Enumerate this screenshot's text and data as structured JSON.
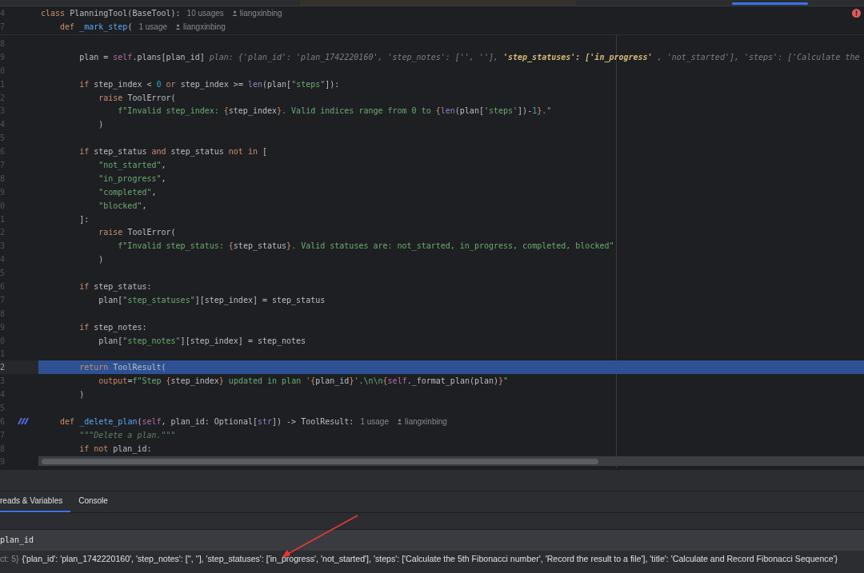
{
  "editor": {
    "problems": {
      "kind": "error"
    },
    "sticky_lines": [
      {
        "number": "4",
        "segments": [
          {
            "kind": "kw",
            "t": "class "
          },
          {
            "kind": "plain",
            "t": "PlanningTool(BaseTool):"
          },
          {
            "kind": "usages",
            "t": "10 usages"
          },
          {
            "kind": "author",
            "t": "liangxinbing"
          }
        ]
      },
      {
        "number": "7",
        "segments": [
          {
            "kind": "kw",
            "t": "    def "
          },
          {
            "kind": "fn",
            "t": "_mark_step"
          },
          {
            "kind": "plain",
            "t": "("
          },
          {
            "kind": "usages",
            "t": "1 usage"
          },
          {
            "kind": "author",
            "t": "liangxinbing"
          }
        ]
      }
    ],
    "lines": [
      {
        "number": "8",
        "current": false,
        "gutter_mark": false
      },
      {
        "number": "9",
        "current": false,
        "gutter_mark": false,
        "segments": [
          {
            "kind": "plain",
            "t": "        plan = "
          },
          {
            "kind": "self",
            "t": "self"
          },
          {
            "kind": "plain",
            "t": ".plans[plan_id]"
          },
          {
            "kind": "hint",
            "t": "plan: {'plan_id': 'plan_1742220160', 'step_notes': ['', ''], "
          },
          {
            "kind": "hint_hl",
            "t": "'step_statuses': ['in_progress'"
          },
          {
            "kind": "hint",
            "t": ", 'not_started'], 'steps': ['Calculate the"
          }
        ]
      },
      {
        "number": "0",
        "current": false,
        "gutter_mark": false
      },
      {
        "number": "1",
        "current": false,
        "gutter_mark": false,
        "segments": [
          {
            "kind": "kw",
            "t": "        if "
          },
          {
            "kind": "plain",
            "t": "step_index < "
          },
          {
            "kind": "num",
            "t": "0"
          },
          {
            "kind": "kw",
            "t": " or "
          },
          {
            "kind": "plain",
            "t": "step_index >= "
          },
          {
            "kind": "builtin",
            "t": "len"
          },
          {
            "kind": "plain",
            "t": "(plan["
          },
          {
            "kind": "str",
            "t": "\"steps\""
          },
          {
            "kind": "plain",
            "t": "]):"
          }
        ]
      },
      {
        "number": "2",
        "current": false,
        "gutter_mark": false,
        "segments": [
          {
            "kind": "kw",
            "t": "            raise "
          },
          {
            "kind": "plain",
            "t": "ToolError("
          }
        ]
      },
      {
        "number": "3",
        "current": false,
        "gutter_mark": false,
        "segments": [
          {
            "kind": "str",
            "t": "                f\"Invalid step_index: "
          },
          {
            "kind": "brace",
            "t": "{"
          },
          {
            "kind": "plain",
            "t": "step_index"
          },
          {
            "kind": "brace",
            "t": "}"
          },
          {
            "kind": "str",
            "t": ". Valid indices range from 0 to "
          },
          {
            "kind": "brace",
            "t": "{"
          },
          {
            "kind": "builtin",
            "t": "len"
          },
          {
            "kind": "plain",
            "t": "(plan["
          },
          {
            "kind": "str",
            "t": "'steps'"
          },
          {
            "kind": "plain",
            "t": "])-"
          },
          {
            "kind": "num",
            "t": "1"
          },
          {
            "kind": "brace",
            "t": "}"
          },
          {
            "kind": "str",
            "t": ".\""
          }
        ]
      },
      {
        "number": "4",
        "current": false,
        "gutter_mark": false,
        "segments": [
          {
            "kind": "plain",
            "t": "            )"
          }
        ]
      },
      {
        "number": "5",
        "current": false,
        "gutter_mark": false
      },
      {
        "number": "6",
        "current": false,
        "gutter_mark": false,
        "segments": [
          {
            "kind": "kw",
            "t": "        if "
          },
          {
            "kind": "plain",
            "t": "step_status "
          },
          {
            "kind": "kw",
            "t": "and "
          },
          {
            "kind": "plain",
            "t": "step_status "
          },
          {
            "kind": "kw",
            "t": "not in "
          },
          {
            "kind": "plain",
            "t": "["
          }
        ]
      },
      {
        "number": "7",
        "current": false,
        "gutter_mark": false,
        "segments": [
          {
            "kind": "str",
            "t": "            \"not_started\""
          },
          {
            "kind": "plain",
            "t": ","
          }
        ]
      },
      {
        "number": "8",
        "current": false,
        "gutter_mark": false,
        "segments": [
          {
            "kind": "str",
            "t": "            \"in_progress\""
          },
          {
            "kind": "plain",
            "t": ","
          }
        ]
      },
      {
        "number": "9",
        "current": false,
        "gutter_mark": false,
        "segments": [
          {
            "kind": "str",
            "t": "            \"completed\""
          },
          {
            "kind": "plain",
            "t": ","
          }
        ]
      },
      {
        "number": "0",
        "current": false,
        "gutter_mark": false,
        "segments": [
          {
            "kind": "str",
            "t": "            \"blocked\""
          },
          {
            "kind": "plain",
            "t": ","
          }
        ]
      },
      {
        "number": "1",
        "current": false,
        "gutter_mark": false,
        "segments": [
          {
            "kind": "plain",
            "t": "        ]:"
          }
        ]
      },
      {
        "number": "2",
        "current": false,
        "gutter_mark": false,
        "segments": [
          {
            "kind": "kw",
            "t": "            raise "
          },
          {
            "kind": "plain",
            "t": "ToolError("
          }
        ]
      },
      {
        "number": "3",
        "current": false,
        "gutter_mark": false,
        "segments": [
          {
            "kind": "str",
            "t": "                f\"Invalid step_status: "
          },
          {
            "kind": "brace",
            "t": "{"
          },
          {
            "kind": "plain",
            "t": "step_status"
          },
          {
            "kind": "brace",
            "t": "}"
          },
          {
            "kind": "str",
            "t": ". Valid statuses are: not_started, in_progress, completed, blocked\""
          }
        ]
      },
      {
        "number": "4",
        "current": false,
        "gutter_mark": false,
        "segments": [
          {
            "kind": "plain",
            "t": "            )"
          }
        ]
      },
      {
        "number": "5",
        "current": false,
        "gutter_mark": false
      },
      {
        "number": "6",
        "current": false,
        "gutter_mark": false,
        "segments": [
          {
            "kind": "kw",
            "t": "        if "
          },
          {
            "kind": "plain",
            "t": "step_status:"
          }
        ]
      },
      {
        "number": "7",
        "current": false,
        "gutter_mark": false,
        "segments": [
          {
            "kind": "plain",
            "t": "            plan["
          },
          {
            "kind": "str",
            "t": "\"step_statuses\""
          },
          {
            "kind": "plain",
            "t": "][step_index] = step_status"
          }
        ]
      },
      {
        "number": "8",
        "current": false,
        "gutter_mark": false
      },
      {
        "number": "9",
        "current": false,
        "gutter_mark": false,
        "segments": [
          {
            "kind": "kw",
            "t": "        if "
          },
          {
            "kind": "plain",
            "t": "step_notes:"
          }
        ]
      },
      {
        "number": "0",
        "current": false,
        "gutter_mark": false,
        "segments": [
          {
            "kind": "plain",
            "t": "            plan["
          },
          {
            "kind": "str",
            "t": "\"step_notes\""
          },
          {
            "kind": "plain",
            "t": "][step_index] = step_notes"
          }
        ]
      },
      {
        "number": "1",
        "current": false,
        "gutter_mark": false
      },
      {
        "number": "2",
        "current": true,
        "gutter_mark": false,
        "segments": [
          {
            "kind": "kw",
            "t": "        return "
          },
          {
            "kind": "plain",
            "t": "ToolResult("
          }
        ]
      },
      {
        "number": "3",
        "current": false,
        "gutter_mark": false,
        "segments": [
          {
            "kind": "param",
            "t": "            output"
          },
          {
            "kind": "plain",
            "t": "="
          },
          {
            "kind": "str",
            "t": "f\"Step "
          },
          {
            "kind": "brace",
            "t": "{"
          },
          {
            "kind": "plain",
            "t": "step_index"
          },
          {
            "kind": "brace",
            "t": "}"
          },
          {
            "kind": "str",
            "t": " updated in plan '"
          },
          {
            "kind": "brace",
            "t": "{"
          },
          {
            "kind": "plain",
            "t": "plan_id"
          },
          {
            "kind": "brace",
            "t": "}"
          },
          {
            "kind": "str",
            "t": "'.\\n\\n"
          },
          {
            "kind": "brace",
            "t": "{"
          },
          {
            "kind": "self",
            "t": "self"
          },
          {
            "kind": "plain",
            "t": "._format_plan(plan)"
          },
          {
            "kind": "brace",
            "t": "}"
          },
          {
            "kind": "str",
            "t": "\""
          }
        ]
      },
      {
        "number": "4",
        "current": false,
        "gutter_mark": false,
        "segments": [
          {
            "kind": "plain",
            "t": "        )"
          }
        ]
      },
      {
        "number": "5",
        "current": false,
        "gutter_mark": false
      },
      {
        "number": "6",
        "current": false,
        "gutter_mark": true,
        "segments": [
          {
            "kind": "kw",
            "t": "    def "
          },
          {
            "kind": "fn",
            "t": "_delete_plan"
          },
          {
            "kind": "plain",
            "t": "("
          },
          {
            "kind": "self",
            "t": "self"
          },
          {
            "kind": "plain",
            "t": ", plan_id: Optional["
          },
          {
            "kind": "builtin",
            "t": "str"
          },
          {
            "kind": "plain",
            "t": "]) -> ToolResult:"
          },
          {
            "kind": "usages",
            "t": "1 usage"
          },
          {
            "kind": "author",
            "t": "liangxinbing"
          }
        ]
      },
      {
        "number": "7",
        "current": false,
        "gutter_mark": false,
        "segments": [
          {
            "kind": "doc",
            "t": "        \"\"\"Delete a plan.\"\"\""
          }
        ]
      },
      {
        "number": "8",
        "current": false,
        "gutter_mark": false,
        "segments": [
          {
            "kind": "kw",
            "t": "        if not "
          },
          {
            "kind": "plain",
            "t": "plan_id:"
          }
        ]
      }
    ],
    "scroll_row_number": "9"
  },
  "debugger": {
    "tabs": [
      {
        "label": "reads & Variables",
        "selected": true
      },
      {
        "label": "Console",
        "selected": false
      }
    ],
    "expression": "plan_id",
    "result": {
      "prefix": "ct: 5}",
      "value": "{'plan_id': 'plan_1742220160', 'step_notes': ['', ''], 'step_statuses': ['in_progress', 'not_started'], 'steps': ['Calculate the 5th Fibonacci number', 'Record the result to a file'], 'title': 'Calculate and Record Fibonacci Sequence'}"
    }
  }
}
